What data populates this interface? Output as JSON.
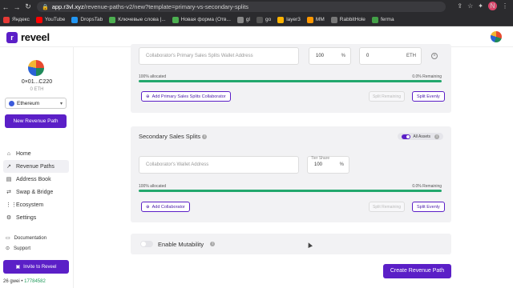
{
  "browser": {
    "url_host": "app.r3vl.xyz",
    "url_path": "/revenue-paths-v2/new?template=primary-vs-secondary-splits",
    "profile_initial": "N",
    "bookmarks": [
      {
        "label": "Яндекс",
        "color": "#e53935"
      },
      {
        "label": "YouTube",
        "color": "#ff0000"
      },
      {
        "label": "DropsTab",
        "color": "#2196f3"
      },
      {
        "label": "Ключевые слова |...",
        "color": "#4caf50"
      },
      {
        "label": "Новая форма (Отв...",
        "color": "#4caf50"
      },
      {
        "label": "gl",
        "color": "#888888"
      },
      {
        "label": "go",
        "color": "#555555"
      },
      {
        "label": "layer3",
        "color": "#ffb300"
      },
      {
        "label": "MM",
        "color": "#ff9800"
      },
      {
        "label": "RabbitHole",
        "color": "#777777"
      },
      {
        "label": "ferma",
        "color": "#43a047"
      }
    ]
  },
  "app": {
    "logo_mark": "r",
    "name": "reveel"
  },
  "sidebar": {
    "wallet_address": "0×01...C220",
    "wallet_balance": "0 ETH",
    "network": "Ethereum",
    "new_path_label": "New Revenue Path",
    "nav": [
      {
        "label": "Home",
        "icon": "⌂",
        "active": false
      },
      {
        "label": "Revenue Paths",
        "icon": "↗",
        "active": true
      },
      {
        "label": "Address Book",
        "icon": "▤",
        "active": false
      },
      {
        "label": "Swap & Bridge",
        "icon": "⇄",
        "active": false
      },
      {
        "label": "Ecosystem",
        "icon": "⋮⋮",
        "active": false
      },
      {
        "label": "Settings",
        "icon": "⚙",
        "active": false
      }
    ],
    "footer": [
      {
        "label": "Documentation",
        "icon": "▭"
      },
      {
        "label": "Support",
        "icon": "⊙"
      }
    ],
    "invite_label": "Invite to Reveel",
    "gas": "26 gwei",
    "block": "17784582"
  },
  "primary": {
    "wallet_placeholder": "Collaborator's Primary Sales Splits Wallet Address",
    "share_value": "100",
    "share_unit": "%",
    "eth_value": "0",
    "eth_unit": "ETH",
    "allocated": "100% allocated",
    "remaining": "0.0% Remaining",
    "add_label": "Add Primary Sales Splits Collaborator",
    "split_remaining": "Split Remaining",
    "split_evenly": "Split Evenly"
  },
  "secondary": {
    "title": "Secondary Sales Splits",
    "assets_label": "All Assets",
    "wallet_placeholder": "Collaborator's Wallet Address",
    "tier_label": "Tier Share",
    "share_value": "100",
    "share_unit": "%",
    "allocated": "100% allocated",
    "remaining": "0.0% Remaining",
    "add_label": "Add Collaborator",
    "split_remaining": "Split Remaining",
    "split_evenly": "Split Evenly"
  },
  "mutability": {
    "label": "Enable Mutability",
    "enabled": false
  },
  "create_label": "Create Revenue Path"
}
